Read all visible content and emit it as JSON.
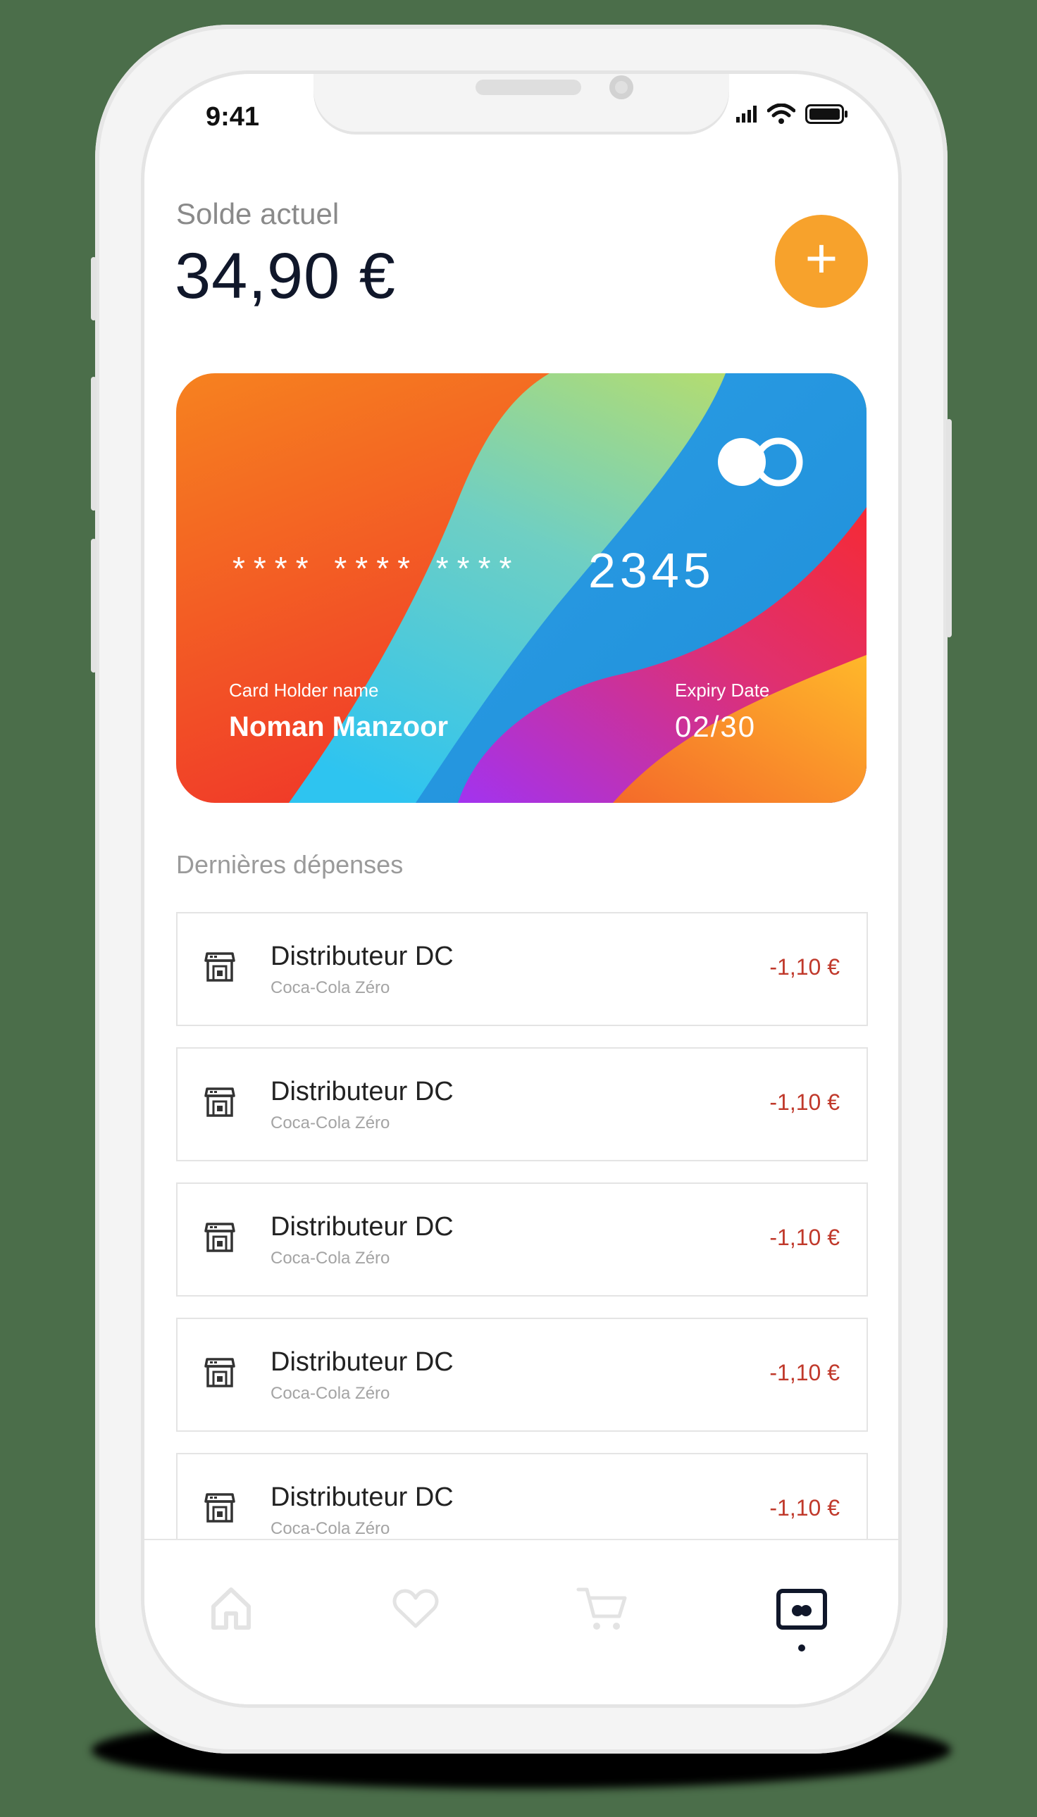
{
  "status_bar": {
    "time": "9:41"
  },
  "balance": {
    "label": "Solde actuel",
    "value": "34,90 €"
  },
  "add_button": {
    "symbol": "+"
  },
  "card": {
    "masked_number": "**** **** ****",
    "last_digits": "2345",
    "holder_label": "Card Holder name",
    "holder_name": "Noman Manzoor",
    "expiry_label": "Expiry Date",
    "expiry": "02/30"
  },
  "expenses": {
    "title": "Dernières dépenses",
    "items": [
      {
        "title": "Distributeur DC",
        "subtitle": "Coca-Cola Zéro",
        "amount": "-1,10 €",
        "icon": "vending-machine-icon"
      },
      {
        "title": "Distributeur DC",
        "subtitle": "Coca-Cola Zéro",
        "amount": "-1,10 €",
        "icon": "vending-machine-icon"
      },
      {
        "title": "Distributeur DC",
        "subtitle": "Coca-Cola Zéro",
        "amount": "-1,10 €",
        "icon": "vending-machine-icon"
      },
      {
        "title": "Distributeur DC",
        "subtitle": "Coca-Cola Zéro",
        "amount": "-1,10 €",
        "icon": "vending-machine-icon"
      },
      {
        "title": "Distributeur DC",
        "subtitle": "Coca-Cola Zéro",
        "amount": "-1,10 €",
        "icon": "vending-machine-icon"
      }
    ]
  },
  "tab_bar": {
    "tabs": [
      {
        "icon": "home-icon",
        "active": false
      },
      {
        "icon": "heart-icon",
        "active": false
      },
      {
        "icon": "cart-icon",
        "active": false
      },
      {
        "icon": "card-icon",
        "active": true
      }
    ]
  },
  "colors": {
    "accent": "#f7a22c",
    "amount": "#c0392b",
    "text_dark": "#10172a"
  }
}
